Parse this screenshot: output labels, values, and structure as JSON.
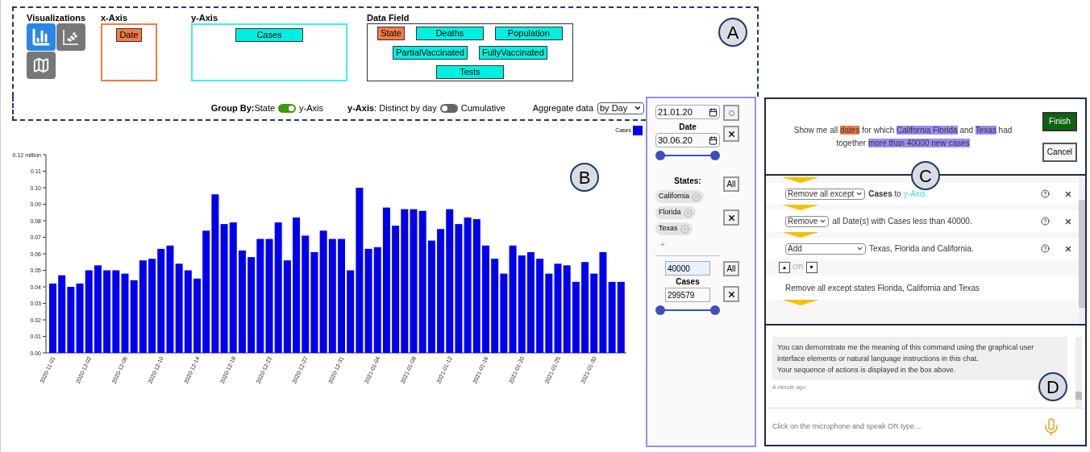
{
  "toolbar": {
    "badge": "A",
    "visualizations": {
      "title": "Visualizations",
      "options": [
        {
          "kind": "bar",
          "selected": true
        },
        {
          "kind": "scatter",
          "selected": false
        },
        {
          "kind": "map",
          "selected": false
        }
      ]
    },
    "x_axis": {
      "title": "x-Axis",
      "fields": [
        {
          "label": "Date",
          "color": "#f47b46"
        }
      ]
    },
    "y_axis": {
      "title": "y-Axis",
      "fields": [
        {
          "label": "Cases",
          "color": "#00f0e0"
        }
      ]
    },
    "data_field": {
      "title": "Data Field",
      "fields": [
        {
          "label": "State",
          "color": "#f47b46"
        },
        {
          "label": "Deaths",
          "color": "#00f0e0"
        },
        {
          "label": "Population",
          "color": "#00f0e0"
        },
        {
          "label": "PartialVaccinated",
          "color": "#00f0e0"
        },
        {
          "label": "FullyVaccinated",
          "color": "#00f0e0"
        },
        {
          "label": "Tests",
          "color": "#00f0e0"
        }
      ]
    },
    "group_by": {
      "label": "**Group By:**State",
      "after": "y-Axis",
      "on": true
    },
    "y_axis_mode": {
      "label": "**y-Axis**: Distinct by day",
      "after": "Cumulative",
      "on": false
    },
    "aggregate": {
      "label": "Aggregate data",
      "value": "by Day"
    }
  },
  "chart": {
    "badge": "B",
    "chart_data": {
      "type": "bar",
      "ylim": [
        0,
        0.12
      ],
      "yticks": [
        {
          "value": 0,
          "label": "0.00"
        },
        {
          "value": 0.01,
          "label": "0.01"
        },
        {
          "value": 0.02,
          "label": "0.02"
        },
        {
          "value": 0.03,
          "label": "0.03"
        },
        {
          "value": 0.04,
          "label": "0.04"
        },
        {
          "value": 0.05,
          "label": "0.05"
        },
        {
          "value": 0.06,
          "label": "0.06"
        },
        {
          "value": 0.07,
          "label": "0.07"
        },
        {
          "value": 0.08,
          "label": "0.08"
        },
        {
          "value": 0.09,
          "label": "0.09"
        },
        {
          "value": 0.1,
          "label": "0.10"
        },
        {
          "value": 0.11,
          "label": "0.11"
        },
        {
          "value": 0.12,
          "label": "0.12 million"
        }
      ],
      "categories": [
        "2020-11-01",
        null,
        null,
        null,
        "2020-12-02",
        null,
        null,
        null,
        "2020-12-06",
        null,
        null,
        null,
        "2020-12-10",
        null,
        null,
        null,
        "2020-12-14",
        null,
        null,
        null,
        "2020-12-18",
        null,
        null,
        null,
        "2020-12-22",
        null,
        null,
        null,
        "2020-12-27",
        null,
        null,
        null,
        "2020-12-31",
        null,
        null,
        null,
        "2021-01-04",
        null,
        null,
        null,
        "2021-01-08",
        null,
        null,
        null,
        "2021-01-12",
        null,
        null,
        null,
        "2021-01-16",
        null,
        null,
        null,
        "2021-01-20",
        null,
        null,
        null,
        "2021-01-25",
        null,
        null,
        null,
        "2021-01-30",
        null,
        null,
        null
      ],
      "series": [
        {
          "name": "Cases",
          "color": "#0000ee",
          "values": [
            0.042,
            0.047,
            0.04,
            0.042,
            0.05,
            0.053,
            0.05,
            0.05,
            0.048,
            0.044,
            0.056,
            0.057,
            0.063,
            0.065,
            0.054,
            0.05,
            0.045,
            0.074,
            0.096,
            0.078,
            0.079,
            0.062,
            0.058,
            0.069,
            0.069,
            0.079,
            0.056,
            0.082,
            0.071,
            0.061,
            0.074,
            0.069,
            0.069,
            0.05,
            0.1,
            0.063,
            0.064,
            0.088,
            0.077,
            0.087,
            0.087,
            0.086,
            0.068,
            0.075,
            0.087,
            0.078,
            0.082,
            0.081,
            0.065,
            0.057,
            0.048,
            0.065,
            0.059,
            0.061,
            0.057,
            0.048,
            0.054,
            0.053,
            0.043,
            0.055,
            0.048,
            0.061,
            0.043,
            0.043
          ]
        }
      ]
    }
  },
  "filters": {
    "date": {
      "from": "21.01.20",
      "label": "Date",
      "to": "30.06.20",
      "handles": [
        {
          "level": 0
        },
        {
          "level": 1
        }
      ]
    },
    "states": {
      "label": "States:",
      "all": "All",
      "chips": [
        "California",
        "Florida",
        "Texas"
      ],
      "add": "+"
    },
    "cases": {
      "min": "40000",
      "label": "Cases",
      "max": "299579",
      "all": "All",
      "handles": [
        {
          "level": 0
        },
        {
          "level": 1
        }
      ]
    }
  },
  "steps": {
    "badge": "C",
    "query": {
      "segments": [
        {
          "text": "Show me all"
        },
        {
          "text": "dates",
          "color": "#f47b46"
        },
        {
          "text": "for which"
        },
        {
          "text": "California Florida",
          "color": "#9b8cf5"
        },
        {
          "text": "and"
        },
        {
          "text": "Texas",
          "color": "#9b8cf5"
        },
        {
          "text": "had together"
        },
        {
          "text": "more than 40000 new cases",
          "color": "#9b8cf5"
        }
      ]
    },
    "finish": "Finish",
    "cancel": "Cancel",
    "items": [
      {
        "action": "Remove all except",
        "text": "**Cases** to",
        "link": "y-Axis."
      },
      {
        "action": "Remove",
        "text": "all Date(s) with Cases less than 40000."
      },
      {
        "action": "Add",
        "text": "Texas, Florida and California."
      }
    ],
    "alternatives": {
      "up": "▲",
      "or": "OR",
      "down": "▼",
      "suggestion": "Remove all except states Florida, California and Texas"
    }
  },
  "chat": {
    "badge": "D",
    "messages": [
      {
        "lines": [
          "You can demonstrate me the meaning of this command using the graphical user interface elements or natural language instructions in this chat.",
          "Your sequence of actions is displayed in the box above."
        ],
        "time": "A minute ago"
      }
    ],
    "placeholder": "Click on the microphone and speak OR type ..."
  }
}
